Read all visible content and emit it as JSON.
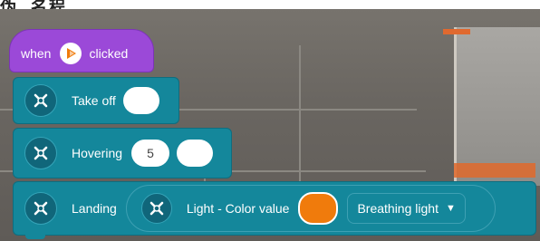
{
  "fragment": "伪. 名程",
  "hat_block": {
    "left_label": "when",
    "right_label": "clicked",
    "icon": "play-icon"
  },
  "blocks": {
    "takeoff": {
      "label": "Take off",
      "icon": "drone-icon",
      "value": ""
    },
    "hover": {
      "label": "Hovering",
      "icon": "drone-icon",
      "number": "5",
      "value": ""
    },
    "landing": {
      "label": "Landing",
      "icon": "drone-icon",
      "inner": {
        "label": "Light - Color value",
        "icon": "drone-icon",
        "color": "#f07b0c",
        "mode": "Breathing light"
      }
    }
  },
  "colors": {
    "event_purple": "#9b49d8",
    "command_teal": "#14879b",
    "orange": "#f07b0c"
  }
}
